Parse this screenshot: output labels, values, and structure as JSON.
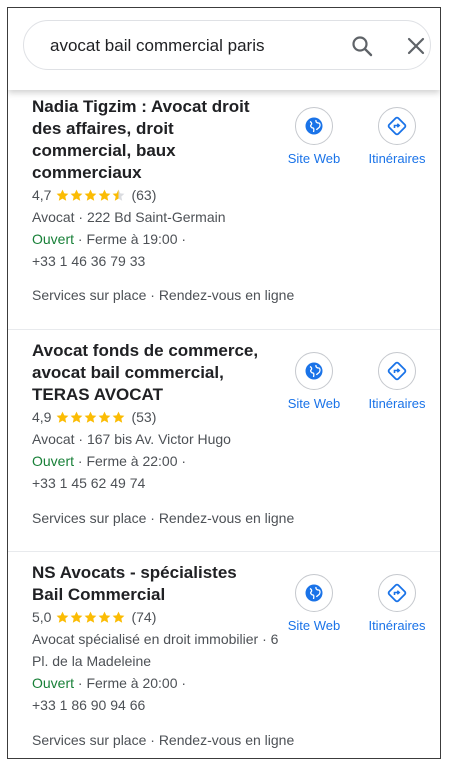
{
  "search": {
    "query": "avocat bail commercial paris",
    "search_icon": "search-icon",
    "close_icon": "close-icon"
  },
  "colors": {
    "open_green": "#188038",
    "link_blue": "#1a73e8",
    "star_gold": "#fbbc04"
  },
  "results": [
    {
      "title": "Nadia Tigzim : Avocat droit des affaires, droit commercial, baux commerciaux",
      "rating": "4,7",
      "stars": 4.5,
      "reviews": "(63)",
      "address": "Avocat · 222 Bd Saint-Germain",
      "open": "Ouvert",
      "hours": " · Ferme à 19:00 ·",
      "phone": "+33 1 46 36 79 33",
      "services": "Services sur place · Rendez-vous en ligne",
      "website_label": "Site Web",
      "directions_label": "Itinéraires"
    },
    {
      "title": "Avocat fonds de commerce, avocat bail commercial, TERAS AVOCAT",
      "rating": "4,9",
      "stars": 5,
      "reviews": "(53)",
      "address": "Avocat · 167 bis Av. Victor Hugo",
      "open": "Ouvert",
      "hours": " · Ferme à 22:00 ·",
      "phone": "+33 1 45 62 49 74",
      "services": "Services sur place · Rendez-vous en ligne",
      "website_label": "Site Web",
      "directions_label": "Itinéraires"
    },
    {
      "title": "NS Avocats - spécialistes Bail Commercial",
      "rating": "5,0",
      "stars": 5,
      "reviews": "(74)",
      "address": "Avocat spécialisé en droit immobilier · 6 Pl. de la Madeleine",
      "open": "Ouvert",
      "hours": " · Ferme à 20:00 ·",
      "phone": "+33 1 86 90 94 66",
      "services": "Services sur place · Rendez-vous en ligne",
      "website_label": "Site Web",
      "directions_label": "Itinéraires"
    }
  ]
}
